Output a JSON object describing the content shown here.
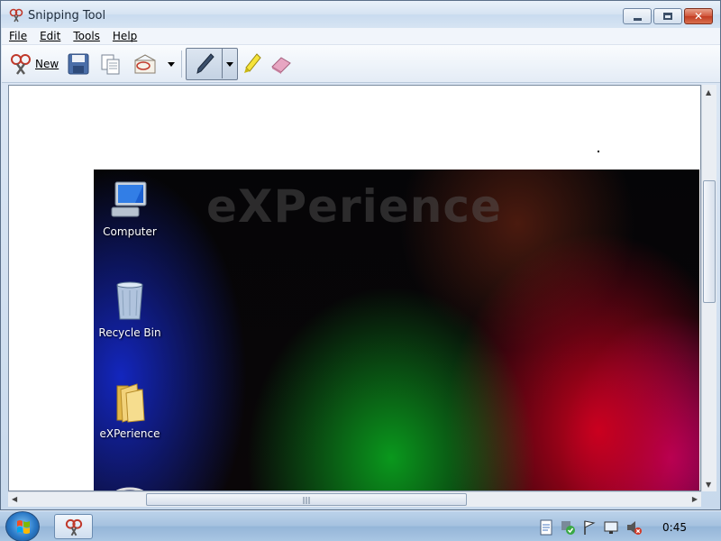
{
  "window": {
    "title": "Snipping Tool"
  },
  "menu": {
    "items": [
      {
        "label": "File"
      },
      {
        "label": "Edit"
      },
      {
        "label": "Tools"
      },
      {
        "label": "Help"
      }
    ]
  },
  "toolbar": {
    "new_label": "New"
  },
  "snip": {
    "wallpaper_title": "eXPerience",
    "desktop_icons": [
      {
        "label": "Computer",
        "icon": "computer-icon"
      },
      {
        "label": "Recycle Bin",
        "icon": "recycle-bin-icon"
      },
      {
        "label": "eXPerience",
        "icon": "folder-icon"
      }
    ]
  },
  "taskbar": {
    "clock": "0:45"
  },
  "colors": {
    "title_bar": "#d5e3f2",
    "canvas_bg": "#ffffff",
    "taskbar": "#a5c1df"
  }
}
